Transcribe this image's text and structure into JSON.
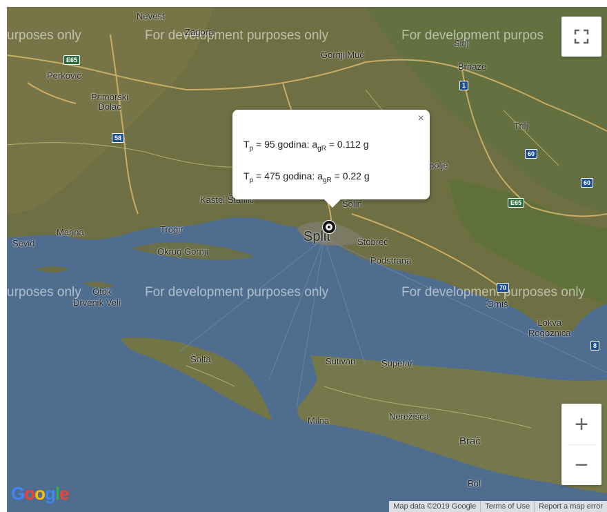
{
  "map": {
    "watermark": "For development purposes only",
    "watermark_cut_left": "urposes only",
    "watermark_cut_right": "For development purpos",
    "places": {
      "nevest": "Nevest",
      "zagora": "Zagora",
      "gornji_muc": "Gornji Muć",
      "brnaze": "Brnaze",
      "perkovic": "Perković",
      "primorski_dolac": "Primorski\nDolac",
      "trilj": "Trilj",
      "dugopolje": "polje",
      "kastel": "Kaštel Štafilić",
      "solin": "Solin",
      "marina": "Marina",
      "trogir": "Trogir",
      "sevid": "Sevid",
      "okrug": "Okrug Gornji",
      "split": "Split",
      "stobrec": "Stobreč",
      "podstrana": "Podstrana",
      "otok": "Otok",
      "drvenik": "Drvenik Veli",
      "omis": "Omiš",
      "lokva": "Lokva\nRogoznica",
      "solta": "Šolta",
      "sutivan": "Sutivan",
      "supetar": "Supetar",
      "milna": "Milna",
      "nerezisca": "Nerežišća",
      "brac": "Brač",
      "bol": "Bol",
      "sinj": "Sinj"
    },
    "shields": {
      "e65a": "E65",
      "e65b": "E65",
      "r1": "1",
      "r58": "58",
      "r60a": "60",
      "r60b": "60",
      "r70": "70",
      "r8": "8"
    }
  },
  "popup": {
    "row1": {
      "t": "T",
      "t_sub": "p",
      "eq": " =  95 godina: a",
      "a_sub": "gR",
      "val": " = 0.112 g"
    },
    "row2": {
      "t": "T",
      "t_sub": "p",
      "eq": " = 475 godina: a",
      "a_sub": "gR",
      "val": " = 0.22 g"
    },
    "close": "×"
  },
  "controls": {
    "zoom_in": "+",
    "zoom_out": "−"
  },
  "logo": "Google",
  "attribution": {
    "data": "Map data ©2019 Google",
    "terms": "Terms of Use",
    "report": "Report a map error"
  }
}
